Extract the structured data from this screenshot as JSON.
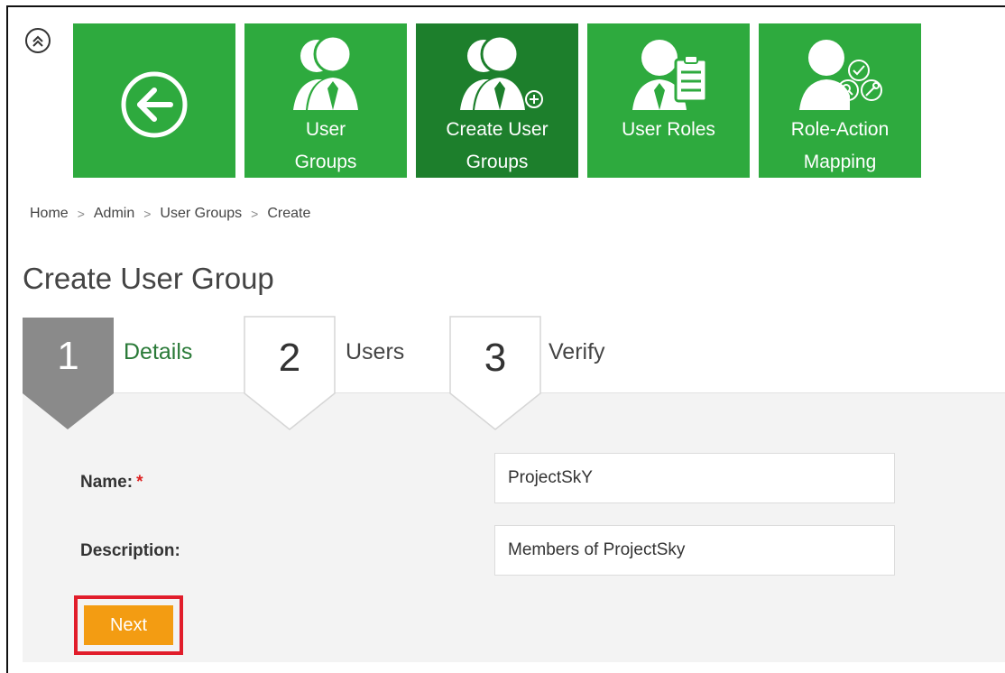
{
  "nav": {
    "tiles": [
      {
        "label": ""
      },
      {
        "label": "User\nGroups"
      },
      {
        "label": "Create User\nGroups"
      },
      {
        "label": "User Roles"
      },
      {
        "label": "Role-Action\nMapping"
      }
    ]
  },
  "breadcrumb": {
    "items": [
      "Home",
      "Admin",
      "User Groups",
      "Create"
    ],
    "separator": ">"
  },
  "page": {
    "title": "Create User Group"
  },
  "wizard": {
    "steps": [
      {
        "number": "1",
        "label": "Details",
        "state": "active"
      },
      {
        "number": "2",
        "label": "Users",
        "state": "pending"
      },
      {
        "number": "3",
        "label": "Verify",
        "state": "pending"
      }
    ]
  },
  "form": {
    "name_label": "Name:",
    "required_mark": "*",
    "name_value": "ProjectSkY",
    "description_label": "Description:",
    "description_value": "Members of ProjectSky"
  },
  "actions": {
    "next_label": "Next"
  },
  "colors": {
    "tile_green": "#2eaa3e",
    "tile_active": "#1d7f2c",
    "step_active": "#8a8a8a",
    "next_button": "#f39c12",
    "highlight": "#e11d2b"
  }
}
